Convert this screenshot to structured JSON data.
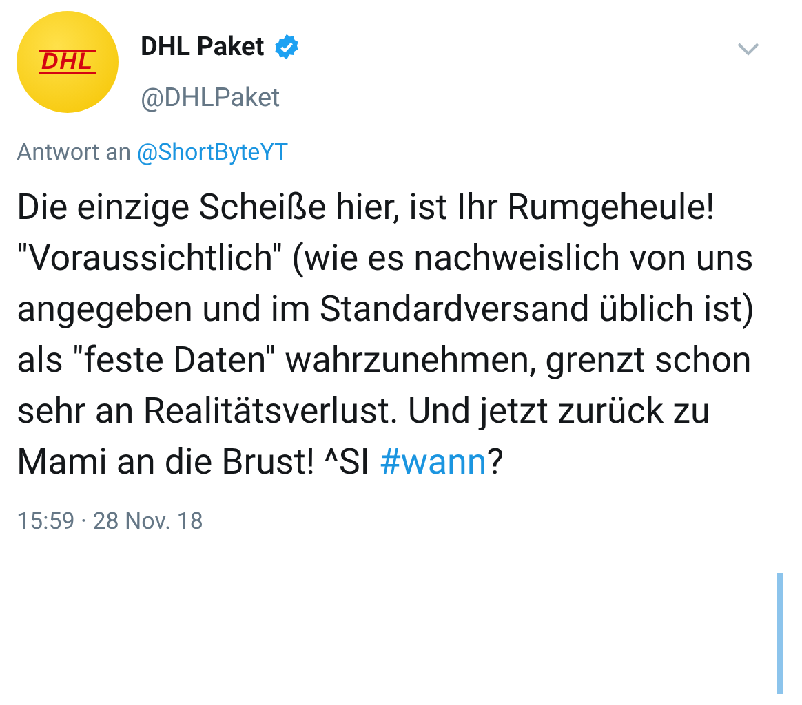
{
  "author": {
    "logo_text": "DHL",
    "name": "DHL Paket",
    "verified": true,
    "handle": "@DHLPaket"
  },
  "reply_to": {
    "label": "Antwort an",
    "handle": "@ShortByteYT"
  },
  "body": {
    "text": "Die einzige Scheiße hier, ist Ihr Rumgeheule! \"Voraussichtlich\" (wie es nachweislich von uns angegeben und im Standardversand üblich ist) als \"feste Daten\" wahrzunehmen, grenzt schon sehr an Realitätsverlust. Und jetzt zurück zu Mami an die Brust! ^SI",
    "hashtag": "#wann",
    "text_after": "?"
  },
  "timestamp": "15:59 · 28 Nov. 18"
}
